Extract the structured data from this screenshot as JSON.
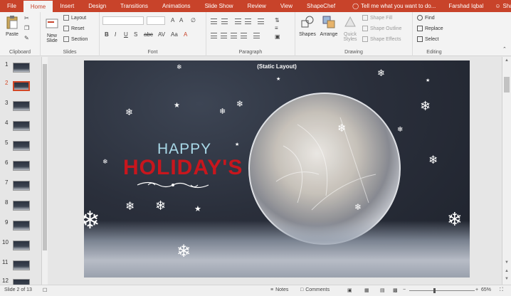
{
  "tabs": [
    "File",
    "Home",
    "Insert",
    "Design",
    "Transitions",
    "Animations",
    "Slide Show",
    "Review",
    "View",
    "ShapeChef"
  ],
  "active_tab": "Home",
  "tell_me": "Tell me what you want to do...",
  "user": "Farshad Iqbal",
  "share": "Share",
  "ribbon": {
    "clipboard": {
      "paste": "Paste",
      "label": "Clipboard"
    },
    "slides": {
      "new_slide": "New Slide",
      "layout": "Layout",
      "reset": "Reset",
      "section": "Section",
      "label": "Slides"
    },
    "font": {
      "label": "Font"
    },
    "paragraph": {
      "label": "Paragraph"
    },
    "drawing": {
      "shapes": "Shapes",
      "arrange": "Arrange",
      "quick_styles": "Quick Styles",
      "shape_fill": "Shape Fill",
      "shape_outline": "Shape Outline",
      "shape_effects": "Shape Effects",
      "label": "Drawing"
    },
    "editing": {
      "find": "Find",
      "replace": "Replace",
      "select": "Select",
      "label": "Editing"
    }
  },
  "thumbnails": [
    "1",
    "2",
    "3",
    "4",
    "5",
    "6",
    "7",
    "8",
    "9",
    "10",
    "11",
    "12"
  ],
  "selected_slide": 2,
  "slide": {
    "layout_label": "(Static Layout)",
    "happy": "HAPPY",
    "holidays": "HOLIDAY'S"
  },
  "status": {
    "slide_info": "Slide 2 of 13",
    "notes": "Notes",
    "comments": "Comments",
    "zoom": "65%"
  },
  "colors": {
    "accent": "#c8432a",
    "title_red": "#c8161d",
    "title_blue": "#a9d9e8"
  }
}
